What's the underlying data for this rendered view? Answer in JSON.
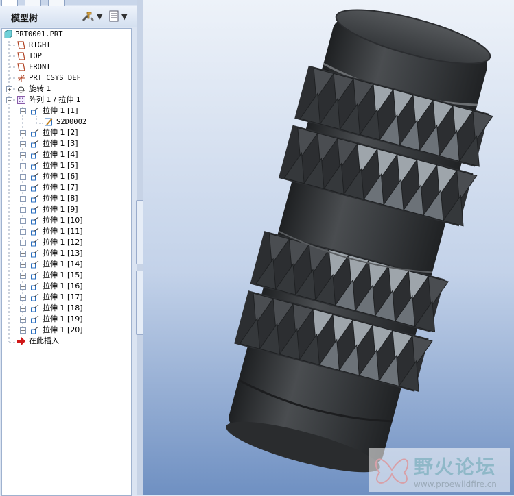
{
  "tree": {
    "title": "模型树",
    "root": "PRT0001.PRT",
    "datums": [
      "RIGHT",
      "TOP",
      "FRONT"
    ],
    "csys": "PRT_CSYS_DEF",
    "revolve": "旋转 1",
    "pattern": "阵列 1 / 拉伸 1",
    "first_member": "拉伸 1 [1]",
    "sketch": "S2D0002",
    "members": [
      "拉伸 1 [2]",
      "拉伸 1 [3]",
      "拉伸 1 [4]",
      "拉伸 1 [5]",
      "拉伸 1 [6]",
      "拉伸 1 [7]",
      "拉伸 1 [8]",
      "拉伸 1 [9]",
      "拉伸 1 [10]",
      "拉伸 1 [11]",
      "拉伸 1 [12]",
      "拉伸 1 [13]",
      "拉伸 1 [14]",
      "拉伸 1 [15]",
      "拉伸 1 [16]",
      "拉伸 1 [17]",
      "拉伸 1 [18]",
      "拉伸 1 [19]",
      "拉伸 1 [20]"
    ],
    "insert_here": "在此插入"
  },
  "watermark": {
    "brand": "野火论坛",
    "url": "www.proewildfire.cn"
  },
  "colors": {
    "model": "#3a3d40",
    "viewport_top": "#edf2f9",
    "viewport_bottom": "#6f90c2"
  }
}
